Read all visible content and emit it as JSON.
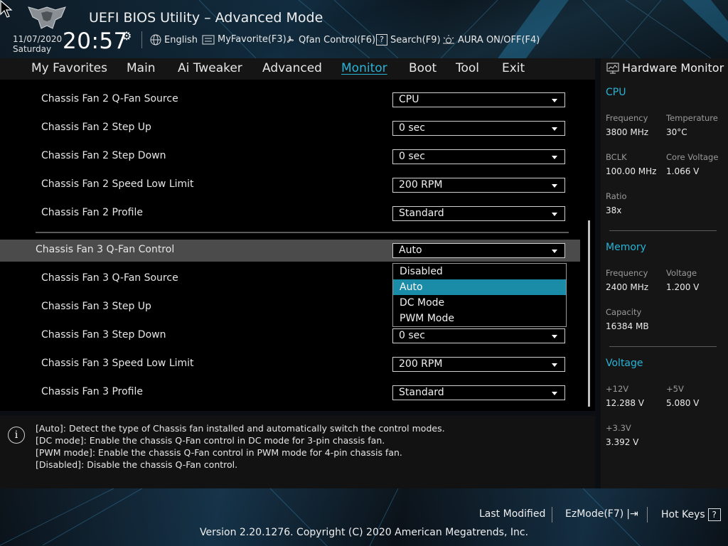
{
  "header": {
    "title": "UEFI BIOS Utility – Advanced Mode",
    "date": "11/07/2020",
    "day": "Saturday",
    "time": "20:57",
    "items": {
      "language": "English",
      "myfavorite": "MyFavorite(F3)",
      "qfan": "Qfan Control(F6)",
      "search": "Search(F9)",
      "aura": "AURA ON/OFF(F4)"
    }
  },
  "tabs": [
    "My Favorites",
    "Main",
    "Ai Tweaker",
    "Advanced",
    "Monitor",
    "Boot",
    "Tool",
    "Exit"
  ],
  "active_tab": "Monitor",
  "settings": [
    {
      "label": "Chassis Fan 2 Q-Fan Source",
      "value": "CPU"
    },
    {
      "label": "Chassis Fan 2 Step Up",
      "value": "0 sec"
    },
    {
      "label": "Chassis Fan 2 Step Down",
      "value": "0 sec"
    },
    {
      "label": "Chassis Fan 2 Speed Low Limit",
      "value": "200 RPM"
    },
    {
      "label": "Chassis Fan 2 Profile",
      "value": "Standard"
    },
    {
      "label": "Chassis Fan 3 Q-Fan Control",
      "value": "Auto"
    },
    {
      "label": "Chassis Fan 3 Q-Fan Source",
      "value": ""
    },
    {
      "label": "Chassis Fan 3 Step Up",
      "value": ""
    },
    {
      "label": "Chassis Fan 3 Step Down",
      "value": "0 sec"
    },
    {
      "label": "Chassis Fan 3 Speed Low Limit",
      "value": "200 RPM"
    },
    {
      "label": "Chassis Fan 3 Profile",
      "value": "Standard"
    }
  ],
  "dropdown": {
    "options": [
      "Disabled",
      "Auto",
      "DC Mode",
      "PWM Mode"
    ],
    "selected": "Auto"
  },
  "help": [
    "[Auto]: Detect the type of Chassis fan installed and automatically switch the control modes.",
    "[DC mode]: Enable the chassis Q-Fan control in DC mode for 3-pin chassis fan.",
    "[PWM mode]: Enable the chassis Q-Fan control in PWM mode for 4-pin chassis fan.",
    "[Disabled]: Disable the chassis Q-Fan control."
  ],
  "hardware_monitor": {
    "title": "Hardware Monitor",
    "cpu": {
      "heading": "CPU",
      "frequency_label": "Frequency",
      "frequency": "3800 MHz",
      "temperature_label": "Temperature",
      "temperature": "30°C",
      "bclk_label": "BCLK",
      "bclk": "100.00 MHz",
      "core_voltage_label": "Core Voltage",
      "core_voltage": "1.066 V",
      "ratio_label": "Ratio",
      "ratio": "38x"
    },
    "memory": {
      "heading": "Memory",
      "frequency_label": "Frequency",
      "frequency": "2400 MHz",
      "voltage_label": "Voltage",
      "voltage": "1.200 V",
      "capacity_label": "Capacity",
      "capacity": "16384 MB"
    },
    "voltage": {
      "heading": "Voltage",
      "v12_label": "+12V",
      "v12": "12.288 V",
      "v5_label": "+5V",
      "v5": "5.080 V",
      "v33_label": "+3.3V",
      "v33": "3.392 V"
    }
  },
  "footer": {
    "last_modified": "Last Modified",
    "ezmode": "EzMode(F7)",
    "hotkeys": "Hot Keys",
    "hotkeys_key": "?",
    "copyright": "Version 2.20.1276. Copyright (C) 2020 American Megatrends, Inc."
  },
  "colors": {
    "accent": "#28b4d7",
    "highlight_row": "#4b4b4b",
    "selected_option": "#1b8ca8"
  }
}
